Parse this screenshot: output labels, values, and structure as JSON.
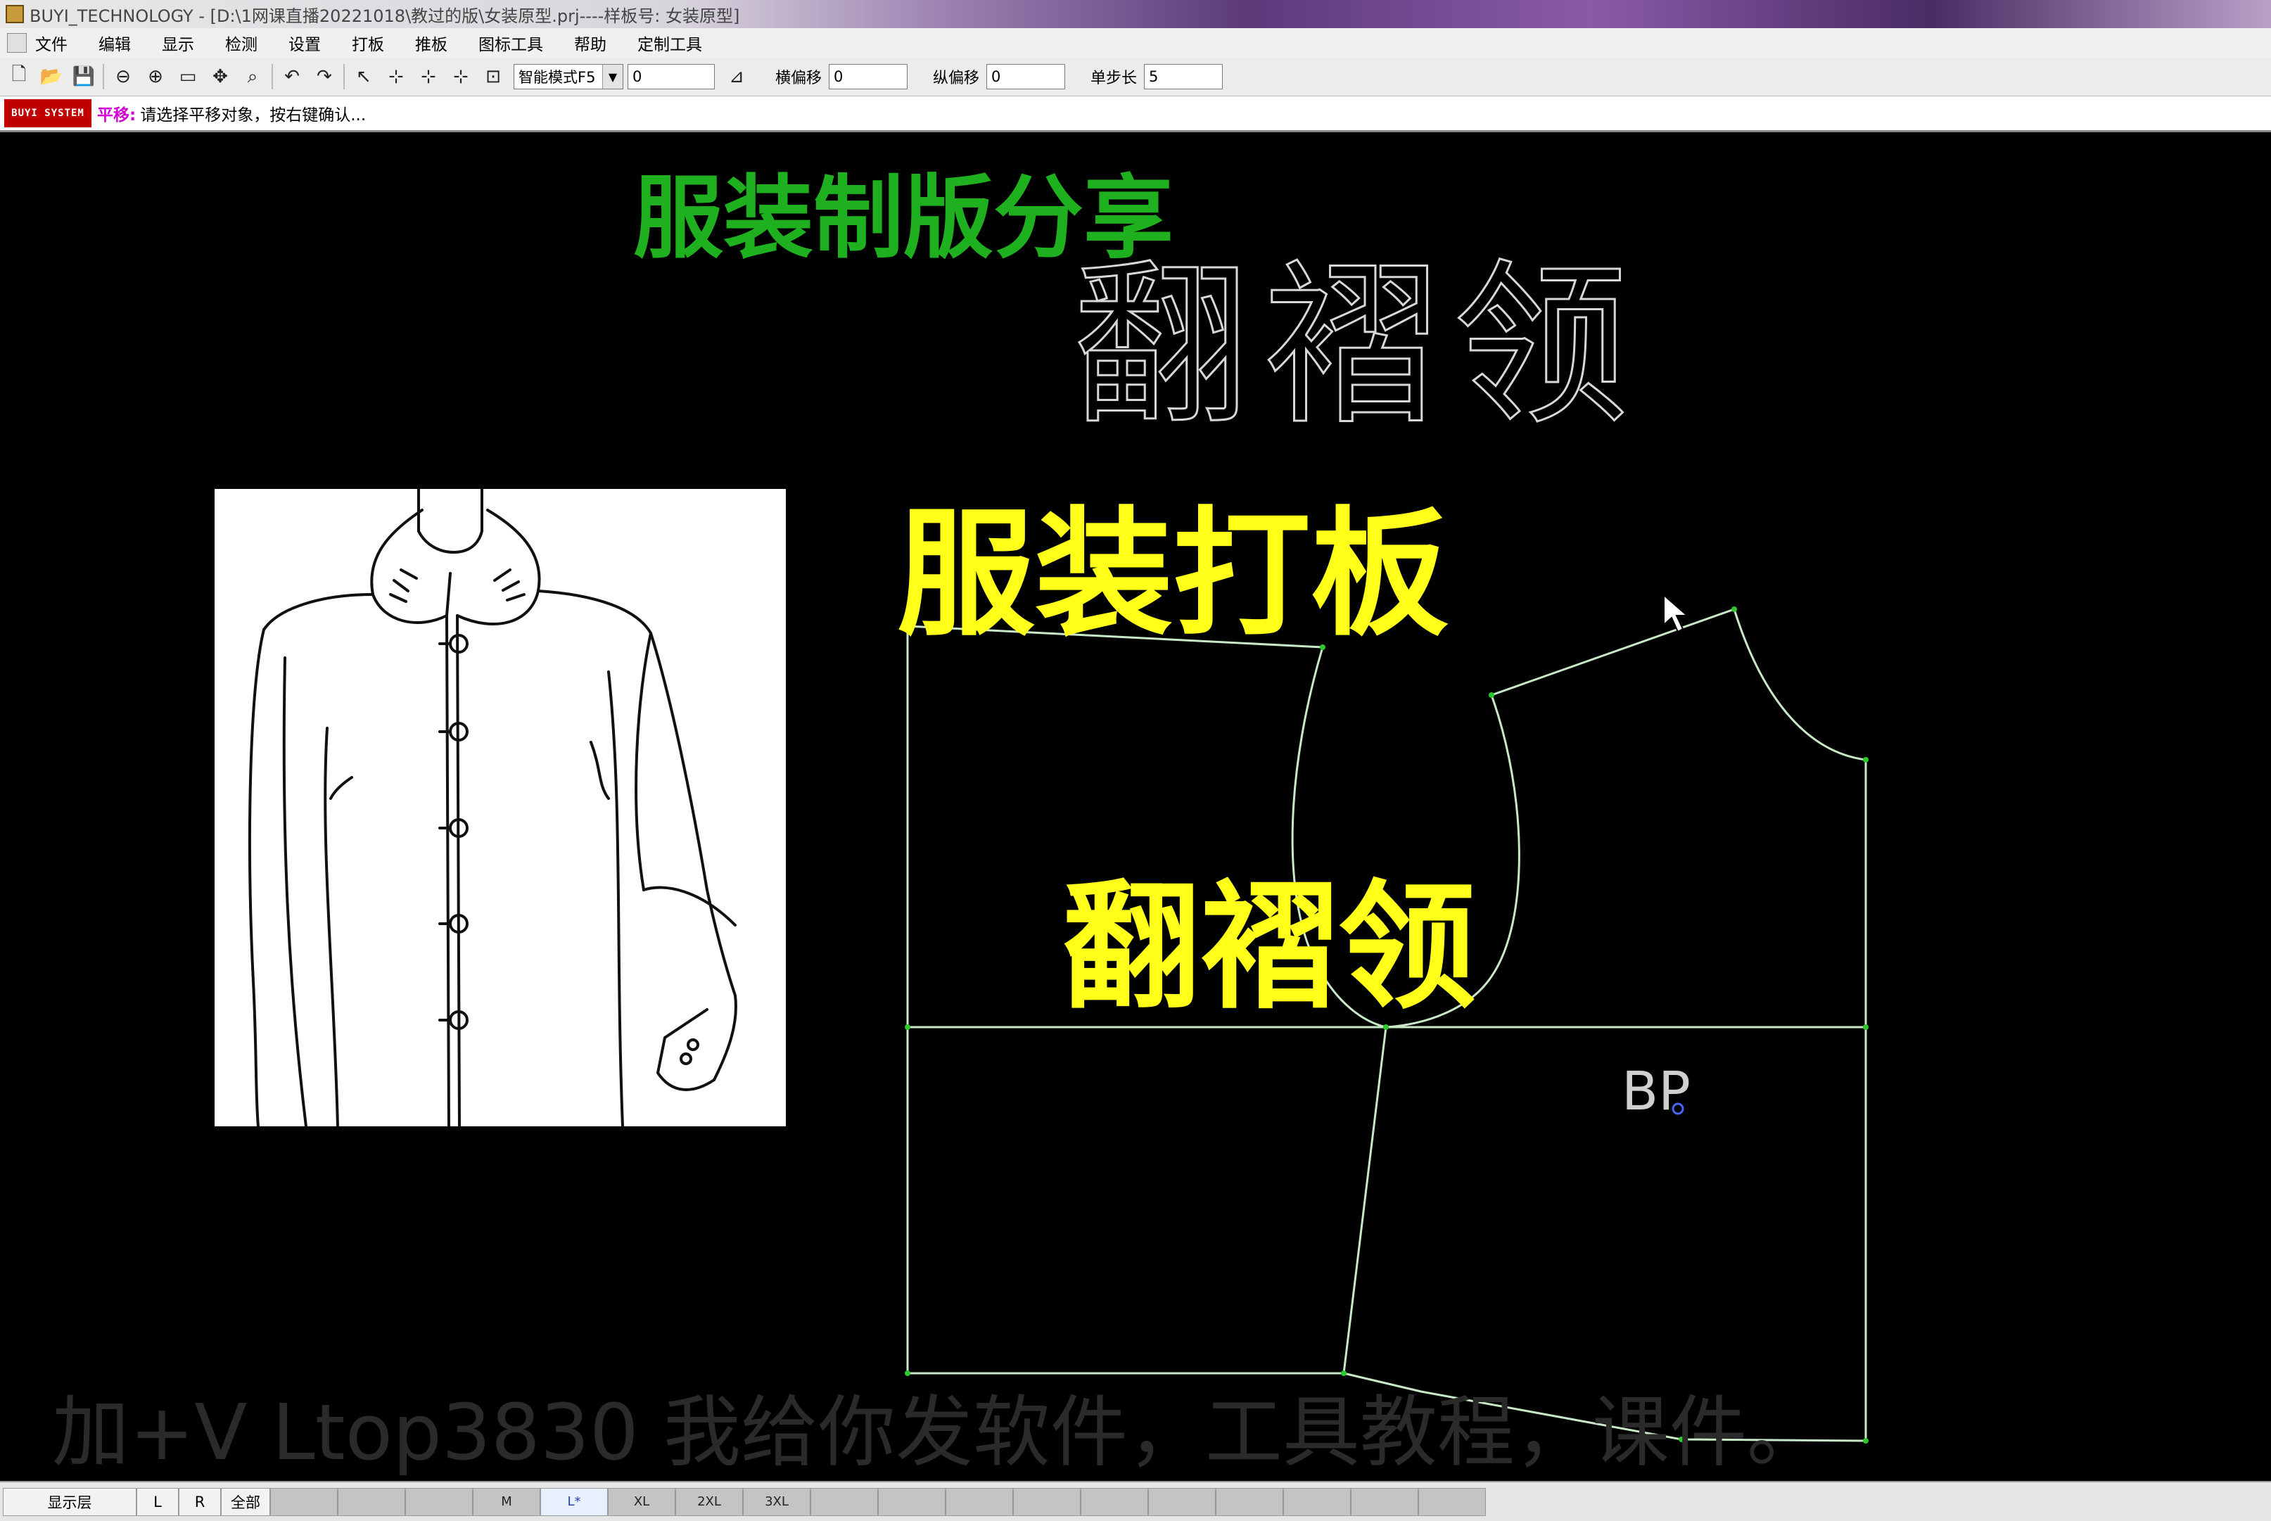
{
  "window": {
    "title": "BUYI_TECHNOLOGY - [D:\\1网课直播20221018\\教过的版\\女装原型.prj----样板号: 女装原型]"
  },
  "menu": {
    "items": [
      "文件",
      "编辑",
      "显示",
      "检测",
      "设置",
      "打板",
      "推板",
      "图标工具",
      "帮助",
      "定制工具"
    ]
  },
  "toolbar": {
    "mode_select": "智能模式F5",
    "value_field": "0",
    "h_offset_label": "横偏移",
    "h_offset_value": "0",
    "v_offset_label": "纵偏移",
    "v_offset_value": "0",
    "step_label": "单步长",
    "step_value": "5"
  },
  "status": {
    "badge": "BUYI SYSTEM",
    "command": "平移:",
    "prompt": "请选择平移对象，按右键确认..."
  },
  "overlays": {
    "title": "服装制版分享",
    "main": "服装打板",
    "sub": "翻褶领",
    "outline_text": "翻褶领",
    "watermark": "加+V Ltop3830 我给你发软件，工具教程，课件。",
    "bp_label": "BP"
  },
  "colors": {
    "overlay_green": "#1eb01e",
    "overlay_yellow": "#ffff1a",
    "pattern_line": "#c8e8c8",
    "point_marker": "#2ec82e",
    "bp_marker": "#4466ff"
  },
  "bottombar": {
    "layer_label": "显示层",
    "l_button": "L",
    "r_button": "R",
    "all_button": "全部",
    "sizes": [
      "",
      "",
      "",
      "M",
      "L*",
      "XL",
      "2XL",
      "3XL",
      "",
      "",
      "",
      "",
      "",
      "",
      "",
      "",
      "",
      ""
    ]
  }
}
